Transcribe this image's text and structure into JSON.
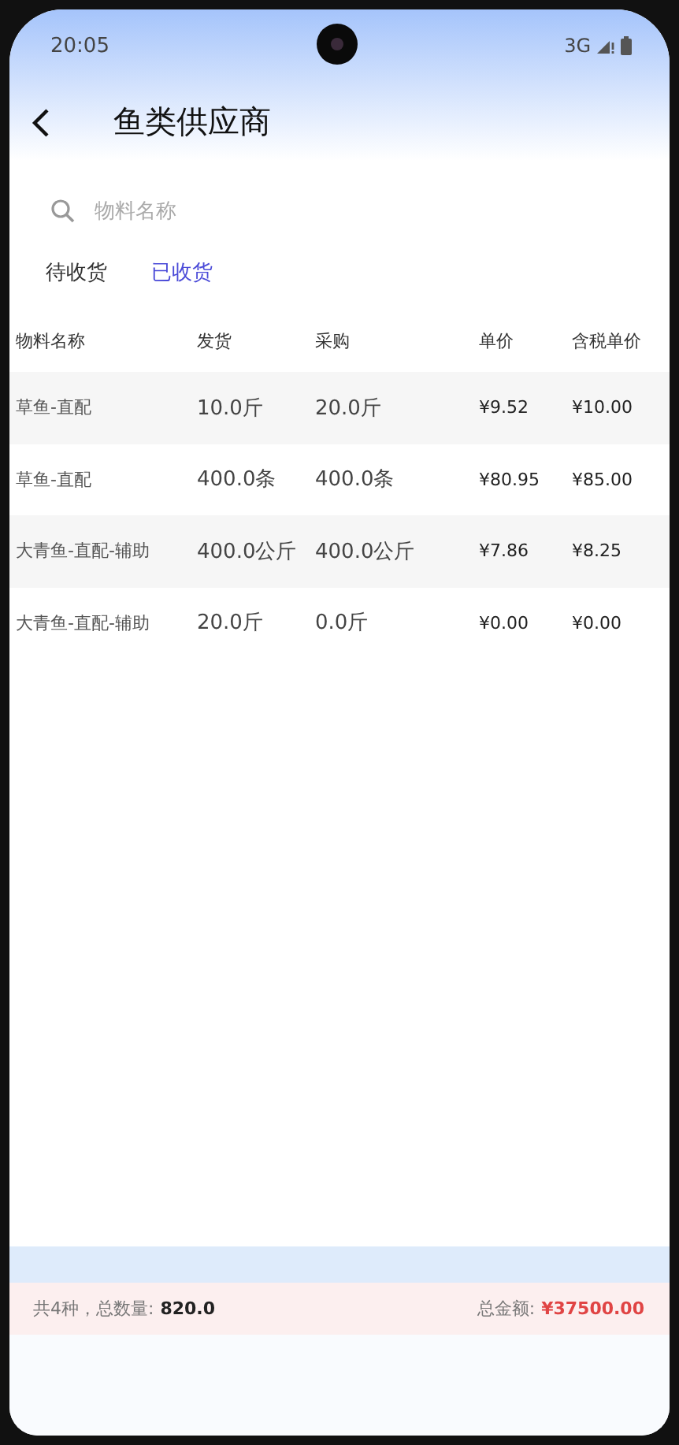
{
  "status_bar": {
    "time": "20:05",
    "network": "3G"
  },
  "header": {
    "title": "鱼类供应商"
  },
  "search": {
    "placeholder": "物料名称"
  },
  "tabs": [
    {
      "label": "待收货",
      "selected": false
    },
    {
      "label": "已收货",
      "selected": true
    }
  ],
  "table": {
    "columns": [
      "物料名称",
      "发货",
      "采购",
      "单价",
      "含税单价"
    ],
    "rows": [
      [
        "草鱼-直配",
        "10.0斤",
        "20.0斤",
        "¥9.52",
        "¥10.00"
      ],
      [
        "草鱼-直配",
        "400.0条",
        "400.0条",
        "¥80.95",
        "¥85.00"
      ],
      [
        "大青鱼-直配-辅助",
        "400.0公斤",
        "400.0公斤",
        "¥7.86",
        "¥8.25"
      ],
      [
        "大青鱼-直配-辅助",
        "20.0斤",
        "0.0斤",
        "¥0.00",
        "¥0.00"
      ]
    ]
  },
  "footer": {
    "count_label": "共4种，总数量:",
    "count_value": "820.0",
    "total_label": "总金额:",
    "total_value": "¥37500.00"
  }
}
